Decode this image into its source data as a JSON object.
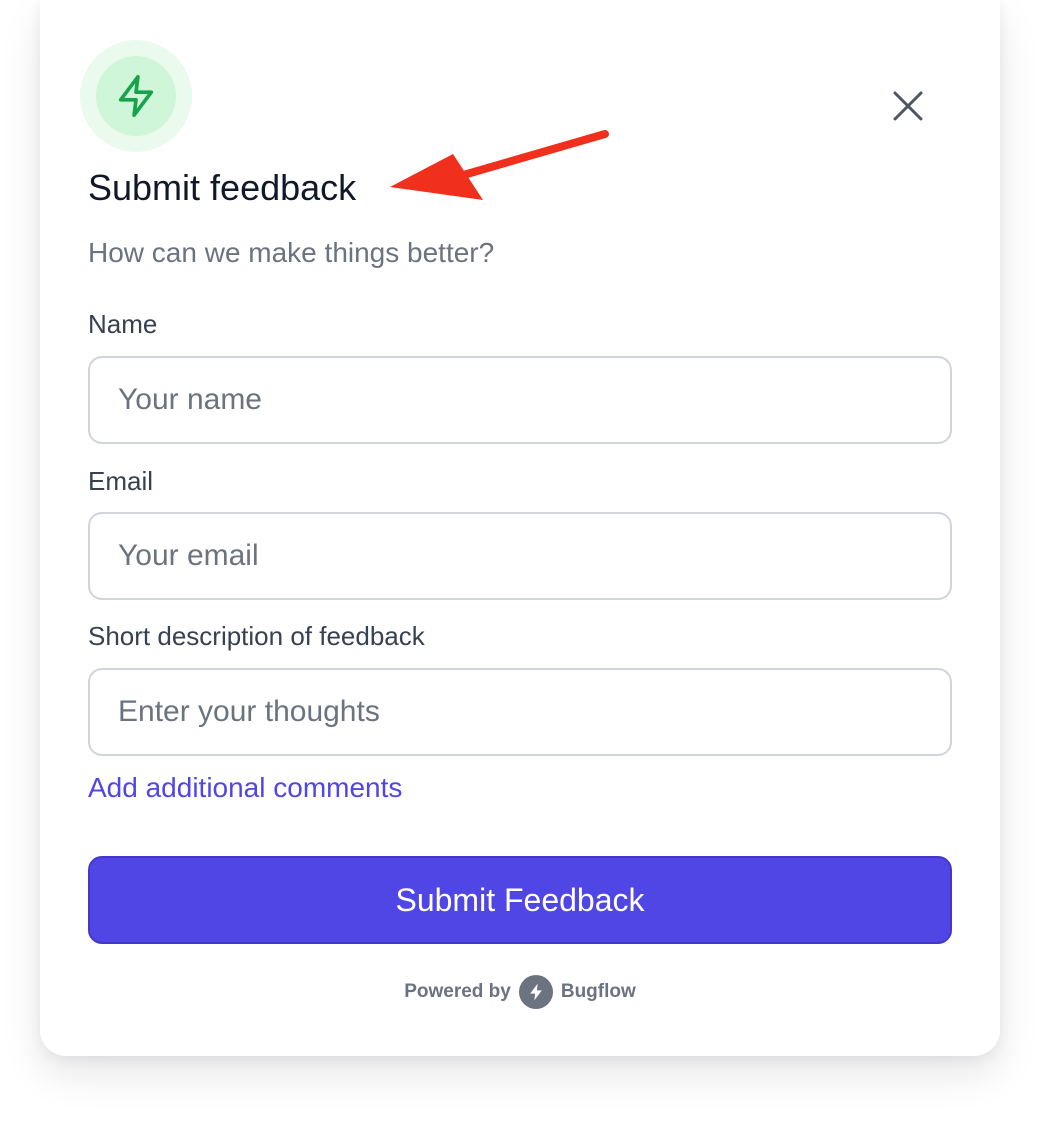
{
  "header": {
    "badge_icon": "lightning-bolt-icon",
    "close_icon": "close-icon",
    "title": "Submit feedback",
    "subtitle": "How can we make things better?"
  },
  "form": {
    "name": {
      "label": "Name",
      "placeholder": "Your name",
      "value": ""
    },
    "email": {
      "label": "Email",
      "placeholder": "Your email",
      "value": ""
    },
    "description": {
      "label": "Short description of feedback",
      "placeholder": "Enter your thoughts",
      "value": ""
    },
    "additional_comments_link": "Add additional comments",
    "submit_label": "Submit Feedback"
  },
  "footer": {
    "powered_by": "Powered by",
    "brand": "Bugflow",
    "brand_icon": "bugflow-bolt-icon"
  },
  "colors": {
    "accent": "#5046e5",
    "link": "#4f46e5",
    "badge_green": "#16a34a",
    "badge_bg": "#cff6d8",
    "annotation_arrow": "#f0301c"
  }
}
